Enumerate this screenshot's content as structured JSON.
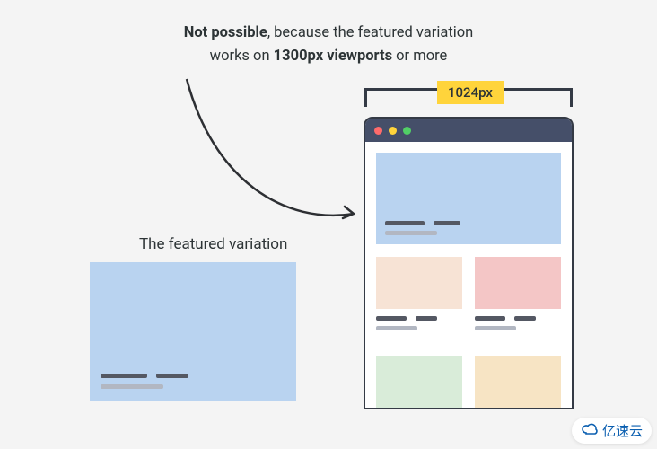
{
  "caption": {
    "prefix": "Not possible",
    "mid1": ", because the featured variation",
    "line2a": "works on ",
    "strong2": "1300px viewports",
    "line2b": " or more"
  },
  "left_label": "The featured variation",
  "dimension_label": "1024px",
  "watermark": "亿速云",
  "colors": {
    "page_bg": "#f4f4f4",
    "card_blue": "#b9d3f0",
    "titlebar": "#454f69",
    "accent_yellow": "#ffd43b",
    "tile_peach": "#f7e3d5",
    "tile_rose": "#f4c6c6",
    "tile_mint": "#d9ecd9",
    "tile_sand": "#f7e4c4"
  }
}
